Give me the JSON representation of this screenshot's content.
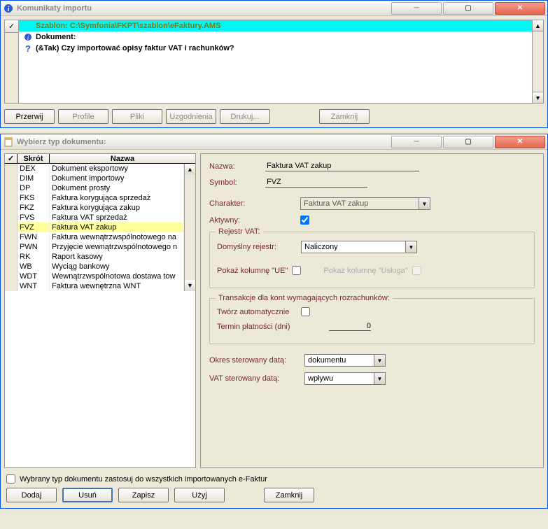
{
  "win1": {
    "title": "Komunikaty importu",
    "rows": [
      {
        "kind": "hl",
        "text": "Szablon: C:\\Symfonia\\FKPT\\szablon\\eFaktury.AMS"
      },
      {
        "kind": "info",
        "text": "Dokument:"
      },
      {
        "kind": "ask",
        "text": "(&Tak) Czy importować opisy faktur VAT i rachunków?"
      }
    ],
    "buttons": {
      "przerwij": "Przerwij",
      "profile": "Profile",
      "pliki": "Pliki",
      "uzgodnienia": "Uzgodnienia",
      "drukuj": "Drukuj...",
      "zamknij": "Zamknij"
    }
  },
  "win2": {
    "title": "Wybierz typ dokumentu:",
    "cols": {
      "check": "✓",
      "skrot": "Skrót",
      "nazwa": "Nazwa"
    },
    "docs": [
      {
        "skrot": "DEX",
        "nazwa": "Dokument eksportowy"
      },
      {
        "skrot": "DIM",
        "nazwa": "Dokument importowy"
      },
      {
        "skrot": "DP",
        "nazwa": "Dokument prosty"
      },
      {
        "skrot": "FKS",
        "nazwa": "Faktura korygująca sprzedaż"
      },
      {
        "skrot": "FKZ",
        "nazwa": "Faktura korygująca zakup"
      },
      {
        "skrot": "FVS",
        "nazwa": "Faktura VAT sprzedaż"
      },
      {
        "skrot": "FVZ",
        "nazwa": "Faktura VAT zakup"
      },
      {
        "skrot": "FWN",
        "nazwa": "Faktura wewnątrzwspólnotowego na"
      },
      {
        "skrot": "PWN",
        "nazwa": "Przyjęcie wewnątrzwspólnotowego n"
      },
      {
        "skrot": "RK",
        "nazwa": "Raport kasowy"
      },
      {
        "skrot": "WB",
        "nazwa": "Wyciąg bankowy"
      },
      {
        "skrot": "WDT",
        "nazwa": "Wewnątrzwspólnotowa dostawa tow"
      },
      {
        "skrot": "WNT",
        "nazwa": "Faktura wewnętrzna WNT"
      }
    ],
    "selectedIndex": 6,
    "form": {
      "nazwa_lbl": "Nazwa:",
      "nazwa_val": "Faktura VAT zakup",
      "symbol_lbl": "Symbol:",
      "symbol_val": "FVZ",
      "charakter_lbl": "Charakter:",
      "charakter_val": "Faktura VAT zakup",
      "aktywny_lbl": "Aktywny:",
      "rejestr_legend": "Rejestr VAT:",
      "domyslny_lbl": "Domyślny rejestr:",
      "domyslny_val": "Naliczony",
      "pokaz_ue_lbl": "Pokaż kolumnę \"UE\"",
      "pokaz_usluga_lbl": "Pokaż kolumnę \"Usługa\"",
      "trans_legend": "Transakcje dla kont wymagających rozrachunków:",
      "tworz_lbl": "Twórz automatycznie",
      "termin_lbl": "Termin płatności (dni)",
      "termin_val": "0",
      "okres_lbl": "Okres sterowany datą:",
      "okres_val": "dokumentu",
      "vat_lbl": "VAT sterowany datą:",
      "vat_val": "wpływu"
    },
    "footer": {
      "cb_label": "Wybrany typ dokumentu zastosuj do wszystkich importowanych e-Faktur",
      "dodaj": "Dodaj",
      "usun": "Usuń",
      "zapisz": "Zapisz",
      "uzyj": "Użyj",
      "zamknij": "Zamknij"
    }
  }
}
